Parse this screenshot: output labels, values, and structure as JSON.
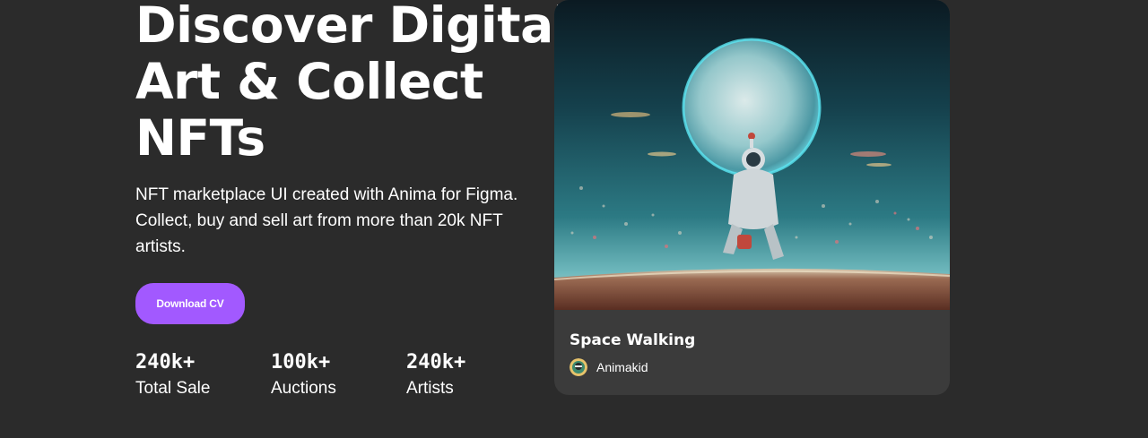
{
  "hero": {
    "headline_lines": [
      "Discover Digital",
      "Art & Collect",
      "NFTs"
    ],
    "subtext": "NFT marketplace UI created with Anima for Figma. Collect, buy and sell art from more than 20k NFT artists.",
    "cta_label": "Download CV",
    "stats": [
      {
        "value": "240k+",
        "label": "Total Sale"
      },
      {
        "value": "100k+",
        "label": "Auctions"
      },
      {
        "value": "240k+",
        "label": "Artists"
      }
    ]
  },
  "featured": {
    "title": "Space Walking",
    "artist": "Animakid"
  },
  "colors": {
    "background": "#2b2b2b",
    "card": "#3b3b3b",
    "accent": "#a259ff",
    "text": "#ffffff"
  }
}
